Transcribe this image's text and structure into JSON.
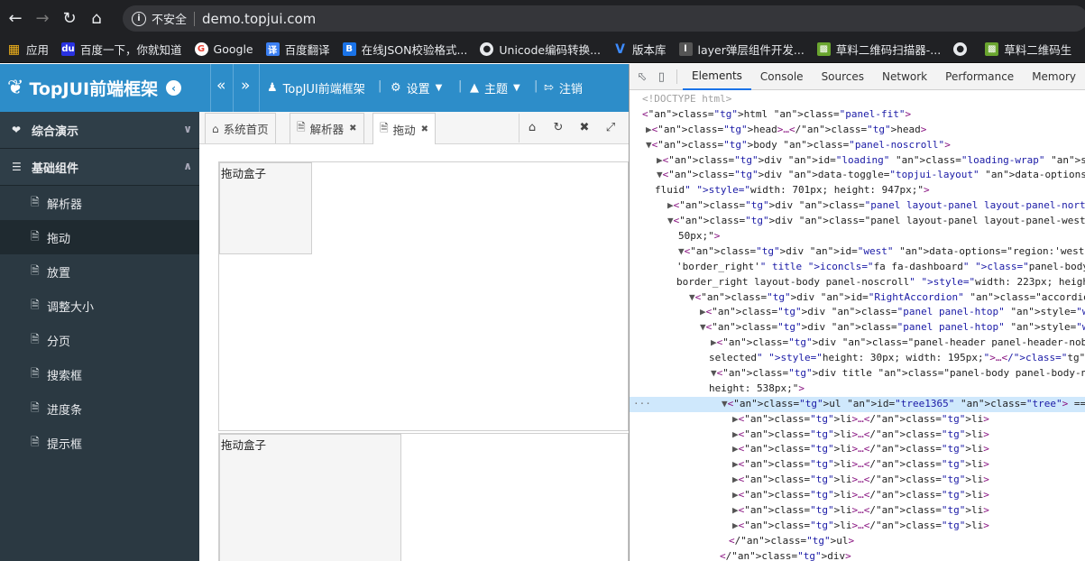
{
  "browser": {
    "security": "不安全",
    "url": "demo.topjui.com",
    "bookmarks": [
      {
        "label": "应用",
        "icon": "apps-grid-icon"
      },
      {
        "label": "百度一下，你就知道",
        "icon": "baidu-icon"
      },
      {
        "label": "Google",
        "icon": "google-icon"
      },
      {
        "label": "百度翻译",
        "icon": "translate-icon"
      },
      {
        "label": "在线JSON校验格式...",
        "icon": "json-icon"
      },
      {
        "label": "Unicode编码转换...",
        "icon": "globe-icon"
      },
      {
        "label": "版本库",
        "icon": "vs-icon"
      },
      {
        "label": "layer弹层组件开发...",
        "icon": "layer-icon"
      },
      {
        "label": "草料二维码扫描器-...",
        "icon": "qrcode-icon"
      },
      {
        "label": "",
        "icon": "globe-icon"
      },
      {
        "label": "草料二维码生",
        "icon": "qrcode-icon"
      }
    ]
  },
  "header": {
    "brand": "TopJUI前端框架",
    "user": "TopJUI前端框架",
    "settings": "设置",
    "theme": "主题",
    "logout": "注销"
  },
  "sidebar": {
    "groups": [
      {
        "label": "综合演示"
      },
      {
        "label": "基础组件"
      }
    ],
    "items": [
      {
        "label": "解析器"
      },
      {
        "label": "拖动"
      },
      {
        "label": "放置"
      },
      {
        "label": "调整大小"
      },
      {
        "label": "分页"
      },
      {
        "label": "搜索框"
      },
      {
        "label": "进度条"
      },
      {
        "label": "提示框"
      }
    ]
  },
  "tabs": [
    {
      "label": "系统首页"
    },
    {
      "label": "解析器"
    },
    {
      "label": "拖动"
    }
  ],
  "content": {
    "box1_label": "拖动盒子",
    "box2_label": "拖动盒子"
  },
  "devtools": {
    "tabs": [
      "Elements",
      "Console",
      "Sources",
      "Network",
      "Performance",
      "Memory"
    ],
    "lines": [
      "<!DOCTYPE html>",
      "<html class=\"panel-fit\">",
      "▶<head>…</head>",
      "▼<body class=\"panel-noscroll\">",
      "▶<div id=\"loading\" class=\"loading-wrap\" style=\"display: none;\">…</div>",
      "▼<div data-toggle=\"topjui-layout\" data-options=\"id:'index_layout',fit:tr",
      "fluid\" style=\"width: 701px; height: 947px;\">",
      "▶<div class=\"panel layout-panel layout-panel-north panel-htop\" style=\"",
      "▼<div class=\"panel layout-panel layout-panel-west panel-htop layout-sp",
      "50px;\">",
      "▼<div id=\"west\" data-options=\"region:'west',split:true,width:230,bor",
      "'border_right'\" title iconcls=\"fa fa-dashboard\" class=\"panel-body pan",
      "border_right layout-body panel-noscroll\" style=\"width: 223px; height:",
      "▼<div id=\"RightAccordion\" class=\"accordion accordion-noborder easyu",
      "▶<div class=\"panel panel-htop\" style=\"width: 223px;\">…</div>",
      "▼<div class=\"panel panel-htop\" style=\"width: 223px;\">",
      "▶<div class=\"panel-header panel-header-noborder accordion-heade",
      "selected\" style=\"height: 30px; width: 195px;\">…</div>",
      "▼<div title class=\"panel-body panel-body-noborder accordion-bod",
      "height: 538px;\">",
      "▼<ul id=\"tree1365\" class=\"tree\"> == $0",
      "▶<li>…</li>",
      "▶<li>…</li>",
      "▶<li>…</li>",
      "▶<li>…</li>",
      "▶<li>…</li>",
      "▶<li>…</li>",
      "▶<li>…</li>",
      "▶<li>…</li>",
      "</ul>",
      "</div>"
    ]
  }
}
